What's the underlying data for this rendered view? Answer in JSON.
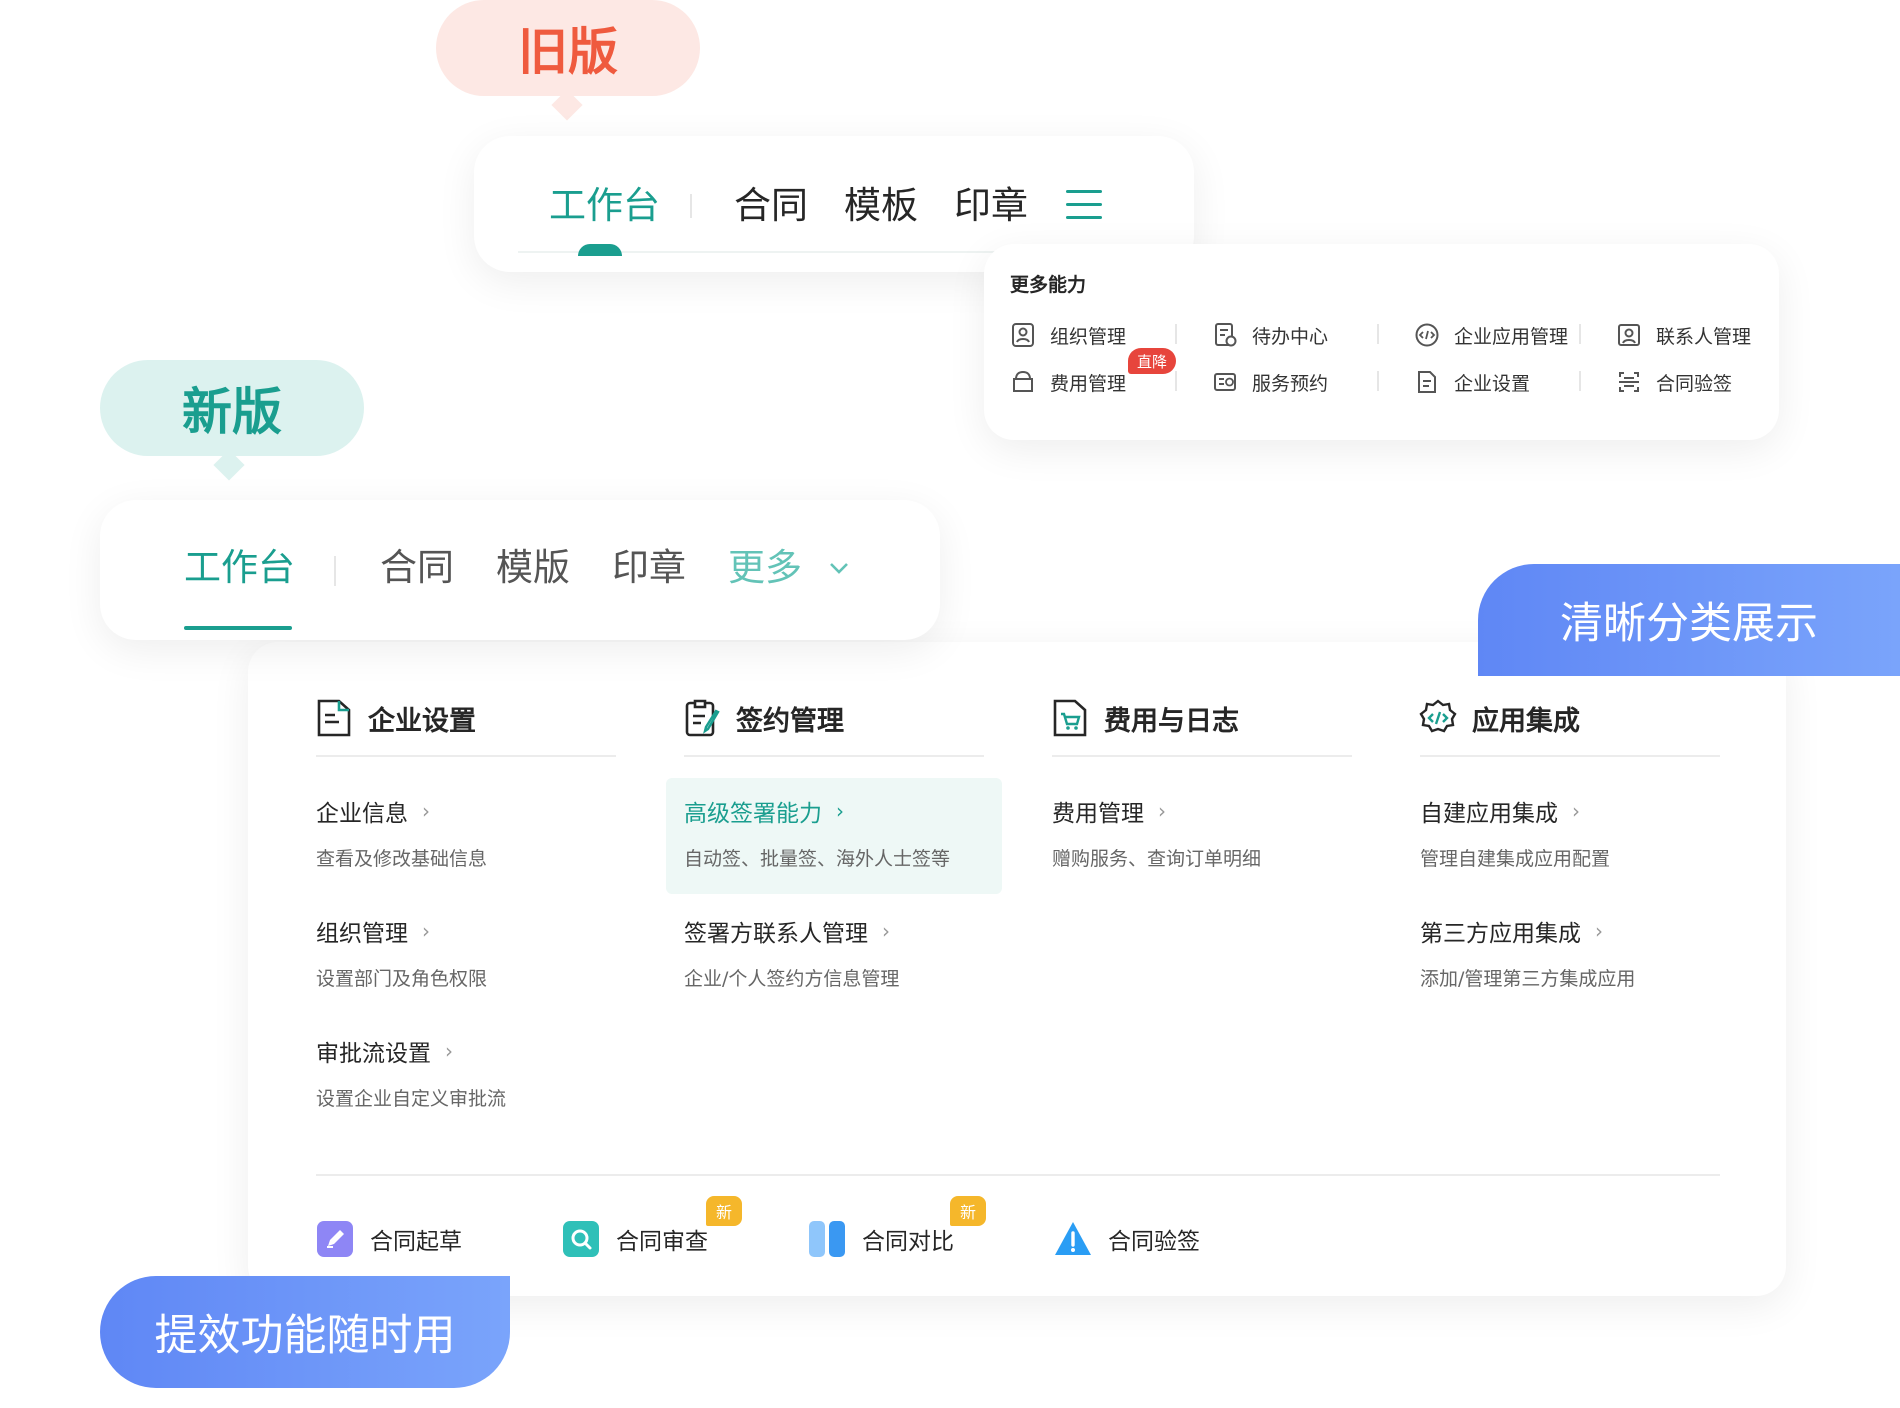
{
  "old_version": {
    "label": "旧版",
    "tabs": [
      {
        "label": "工作台",
        "active": true
      },
      {
        "label": "合同"
      },
      {
        "label": "模板"
      },
      {
        "label": "印章"
      }
    ],
    "menu_icon": "hamburger-icon",
    "dropdown": {
      "title": "更多能力",
      "items": [
        {
          "label": "组织管理",
          "icon": "org-icon"
        },
        {
          "label": "待办中心",
          "icon": "todo-icon"
        },
        {
          "label": "企业应用管理",
          "icon": "code-icon"
        },
        {
          "label": "联系人管理",
          "icon": "contact-icon"
        },
        {
          "label": "费用管理",
          "icon": "wallet-icon",
          "badge": "直降"
        },
        {
          "label": "服务预约",
          "icon": "service-icon"
        },
        {
          "label": "企业设置",
          "icon": "doc-icon"
        },
        {
          "label": "合同验签",
          "icon": "verify-icon"
        }
      ]
    }
  },
  "new_version": {
    "label": "新版",
    "tabs": [
      {
        "label": "工作台",
        "active": true
      },
      {
        "label": "合同"
      },
      {
        "label": "模版"
      },
      {
        "label": "印章"
      },
      {
        "label": "更多",
        "highlight": true
      }
    ],
    "feature_right": "清晰分类展示",
    "feature_left": "提效功能随时用",
    "columns": [
      {
        "title": "企业设置",
        "icon": "enterprise-settings-icon",
        "items": [
          {
            "title": "企业信息",
            "desc": "查看及修改基础信息"
          },
          {
            "title": "组织管理",
            "desc": "设置部门及角色权限"
          },
          {
            "title": "审批流设置",
            "desc": "设置企业自定义审批流"
          }
        ]
      },
      {
        "title": "签约管理",
        "icon": "sign-management-icon",
        "items": [
          {
            "title": "高级签署能力",
            "desc": "自动签、批量签、海外人士签等",
            "highlighted": true
          },
          {
            "title": "签署方联系人管理",
            "desc": "企业/个人签约方信息管理"
          }
        ]
      },
      {
        "title": "费用与日志",
        "icon": "cost-log-icon",
        "items": [
          {
            "title": "费用管理",
            "desc": "赠购服务、查询订单明细"
          }
        ]
      },
      {
        "title": "应用集成",
        "icon": "app-integration-icon",
        "items": [
          {
            "title": "自建应用集成",
            "desc": "管理自建集成应用配置"
          },
          {
            "title": "第三方应用集成",
            "desc": "添加/管理第三方集成应用"
          }
        ]
      }
    ],
    "quick_actions": [
      {
        "label": "合同起草",
        "icon": "pen-icon",
        "color": "#8e86f5"
      },
      {
        "label": "合同审查",
        "icon": "search-icon",
        "color": "#2fc0b8",
        "badge": "新"
      },
      {
        "label": "合同对比",
        "icon": "compare-icon",
        "color": "#5aaef5",
        "badge": "新"
      },
      {
        "label": "合同验签",
        "icon": "warning-icon",
        "color": "#2a9df4"
      }
    ]
  },
  "colors": {
    "accent": "#1a9e8f",
    "old_label": "#ef5a3e",
    "old_bubble": "#fde8e4",
    "new_bubble": "#dcf2ef",
    "feature_blue": "#6c95f7",
    "badge_red": "#e7453c",
    "badge_yellow": "#f5b72b"
  }
}
